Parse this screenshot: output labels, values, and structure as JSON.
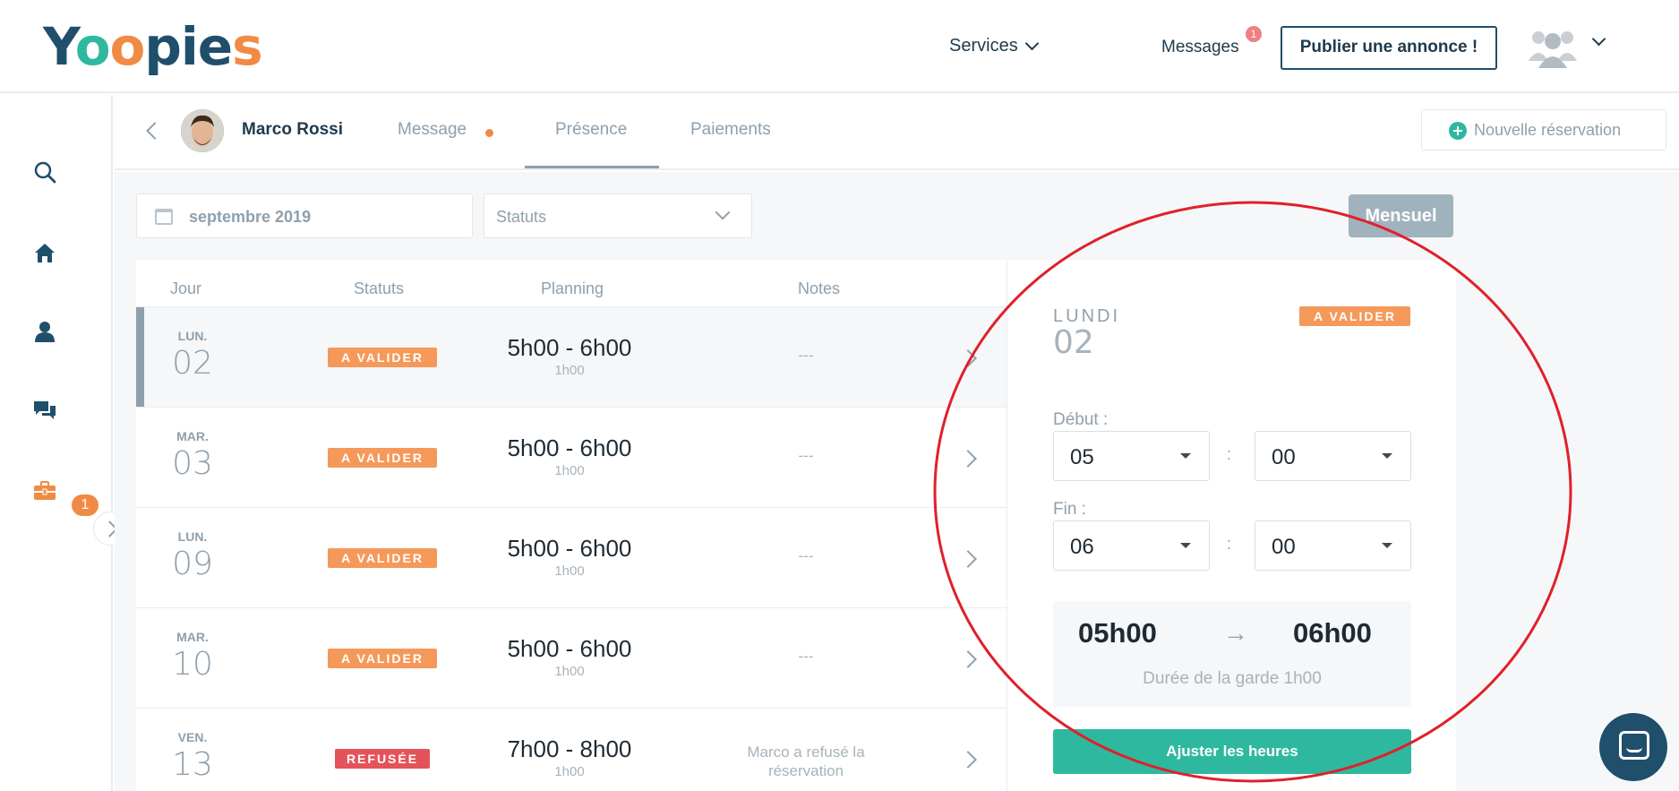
{
  "header": {
    "logo": {
      "y": "Y",
      "o1": "o",
      "o2": "o",
      "rest": "pie",
      "s": "s"
    },
    "services_label": "Services",
    "messages_label": "Messages",
    "messages_count": "1",
    "publish_label": "Publier une annonce !"
  },
  "sidebar": {
    "chat_badge": "1",
    "icons": [
      "search-icon",
      "home-icon",
      "user-icon",
      "chat-icon",
      "briefcase-icon"
    ]
  },
  "subheader": {
    "person_name": "Marco Rossi",
    "tabs": [
      {
        "label": "Message"
      },
      {
        "label": "Présence"
      },
      {
        "label": "Paiements"
      }
    ],
    "new_reservation_label": "Nouvelle réservation"
  },
  "filters": {
    "month": "septembre 2019",
    "status_placeholder": "Statuts",
    "view_button": "Mensuel"
  },
  "table": {
    "headers": {
      "day": "Jour",
      "status": "Statuts",
      "planning": "Planning",
      "notes": "Notes"
    },
    "rows": [
      {
        "day_name": "LUN.",
        "day_num": "02",
        "status": "A VALIDER",
        "planning": "5h00 - 6h00",
        "duration": "1h00",
        "note": "---"
      },
      {
        "day_name": "MAR.",
        "day_num": "03",
        "status": "A VALIDER",
        "planning": "5h00 - 6h00",
        "duration": "1h00",
        "note": "---"
      },
      {
        "day_name": "LUN.",
        "day_num": "09",
        "status": "A VALIDER",
        "planning": "5h00 - 6h00",
        "duration": "1h00",
        "note": "---"
      },
      {
        "day_name": "MAR.",
        "day_num": "10",
        "status": "A VALIDER",
        "planning": "5h00 - 6h00",
        "duration": "1h00",
        "note": "---"
      },
      {
        "day_name": "VEN.",
        "day_num": "13",
        "status": "REFUSÉE",
        "planning": "7h00 - 8h00",
        "duration": "1h00",
        "note_line1": "Marco a refusé la",
        "note_line2": "réservation"
      }
    ]
  },
  "detail": {
    "day_name": "LUNDI",
    "day_num": "02",
    "status": "A VALIDER",
    "start_label": "Début :",
    "start_hour": "05",
    "start_min": "00",
    "end_label": "Fin :",
    "end_hour": "06",
    "end_min": "00",
    "colon": ":",
    "summary_start": "05h00",
    "summary_arrow": "→",
    "summary_end": "06h00",
    "duration_label": "Durée de la garde 1h00",
    "adjust_button": "Ajuster les heures"
  },
  "colors": {
    "primary": "#1f4f6b",
    "teal": "#2fb8a0",
    "orange": "#f5995a",
    "red": "#e5535a",
    "annotation": "#e0202a"
  }
}
